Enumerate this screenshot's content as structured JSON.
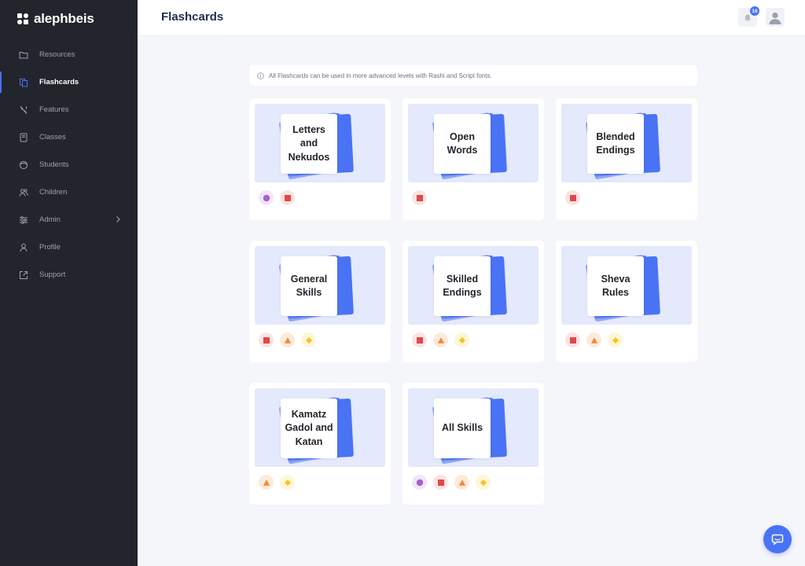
{
  "app": {
    "name": "alephbeis"
  },
  "sidebar": {
    "items": [
      {
        "label": "Resources",
        "icon": "folder-icon"
      },
      {
        "label": "Flashcards",
        "icon": "cards-icon",
        "active": true
      },
      {
        "label": "Features",
        "icon": "aleph-icon"
      },
      {
        "label": "Classes",
        "icon": "book-icon"
      },
      {
        "label": "Students",
        "icon": "face-icon"
      },
      {
        "label": "Children",
        "icon": "users-icon"
      },
      {
        "label": "Admin",
        "icon": "sliders-icon",
        "has_submenu": true
      },
      {
        "label": "Profile",
        "icon": "user-icon"
      },
      {
        "label": "Support",
        "icon": "external-link-icon"
      }
    ]
  },
  "header": {
    "title": "Flashcards",
    "notification_count": "16"
  },
  "info": {
    "text": "All Flashcards can be used in more advanced levels with Rashi and Script fonts."
  },
  "colors": {
    "accent": "#4a72f5",
    "circle_badge": "#a460c8",
    "square_badge": "#e04848",
    "triangle_badge": "#ee8a3a",
    "diamond_badge": "#f5c518"
  },
  "cards": [
    {
      "title": "Letters and Nekudos",
      "badges": [
        "circle",
        "square"
      ]
    },
    {
      "title": "Open Words",
      "badges": [
        "square"
      ]
    },
    {
      "title": "Blended Endings",
      "badges": [
        "square"
      ]
    },
    {
      "title": "General Skills",
      "badges": [
        "square",
        "triangle",
        "diamond"
      ]
    },
    {
      "title": "Skilled Endings",
      "badges": [
        "square",
        "triangle",
        "diamond"
      ]
    },
    {
      "title": "Sheva Rules",
      "badges": [
        "square",
        "triangle",
        "diamond"
      ]
    },
    {
      "title": "Kamatz Gadol and Katan",
      "badges": [
        "triangle",
        "diamond"
      ]
    },
    {
      "title": "All Skills",
      "badges": [
        "circle",
        "square",
        "triangle",
        "diamond"
      ]
    }
  ]
}
